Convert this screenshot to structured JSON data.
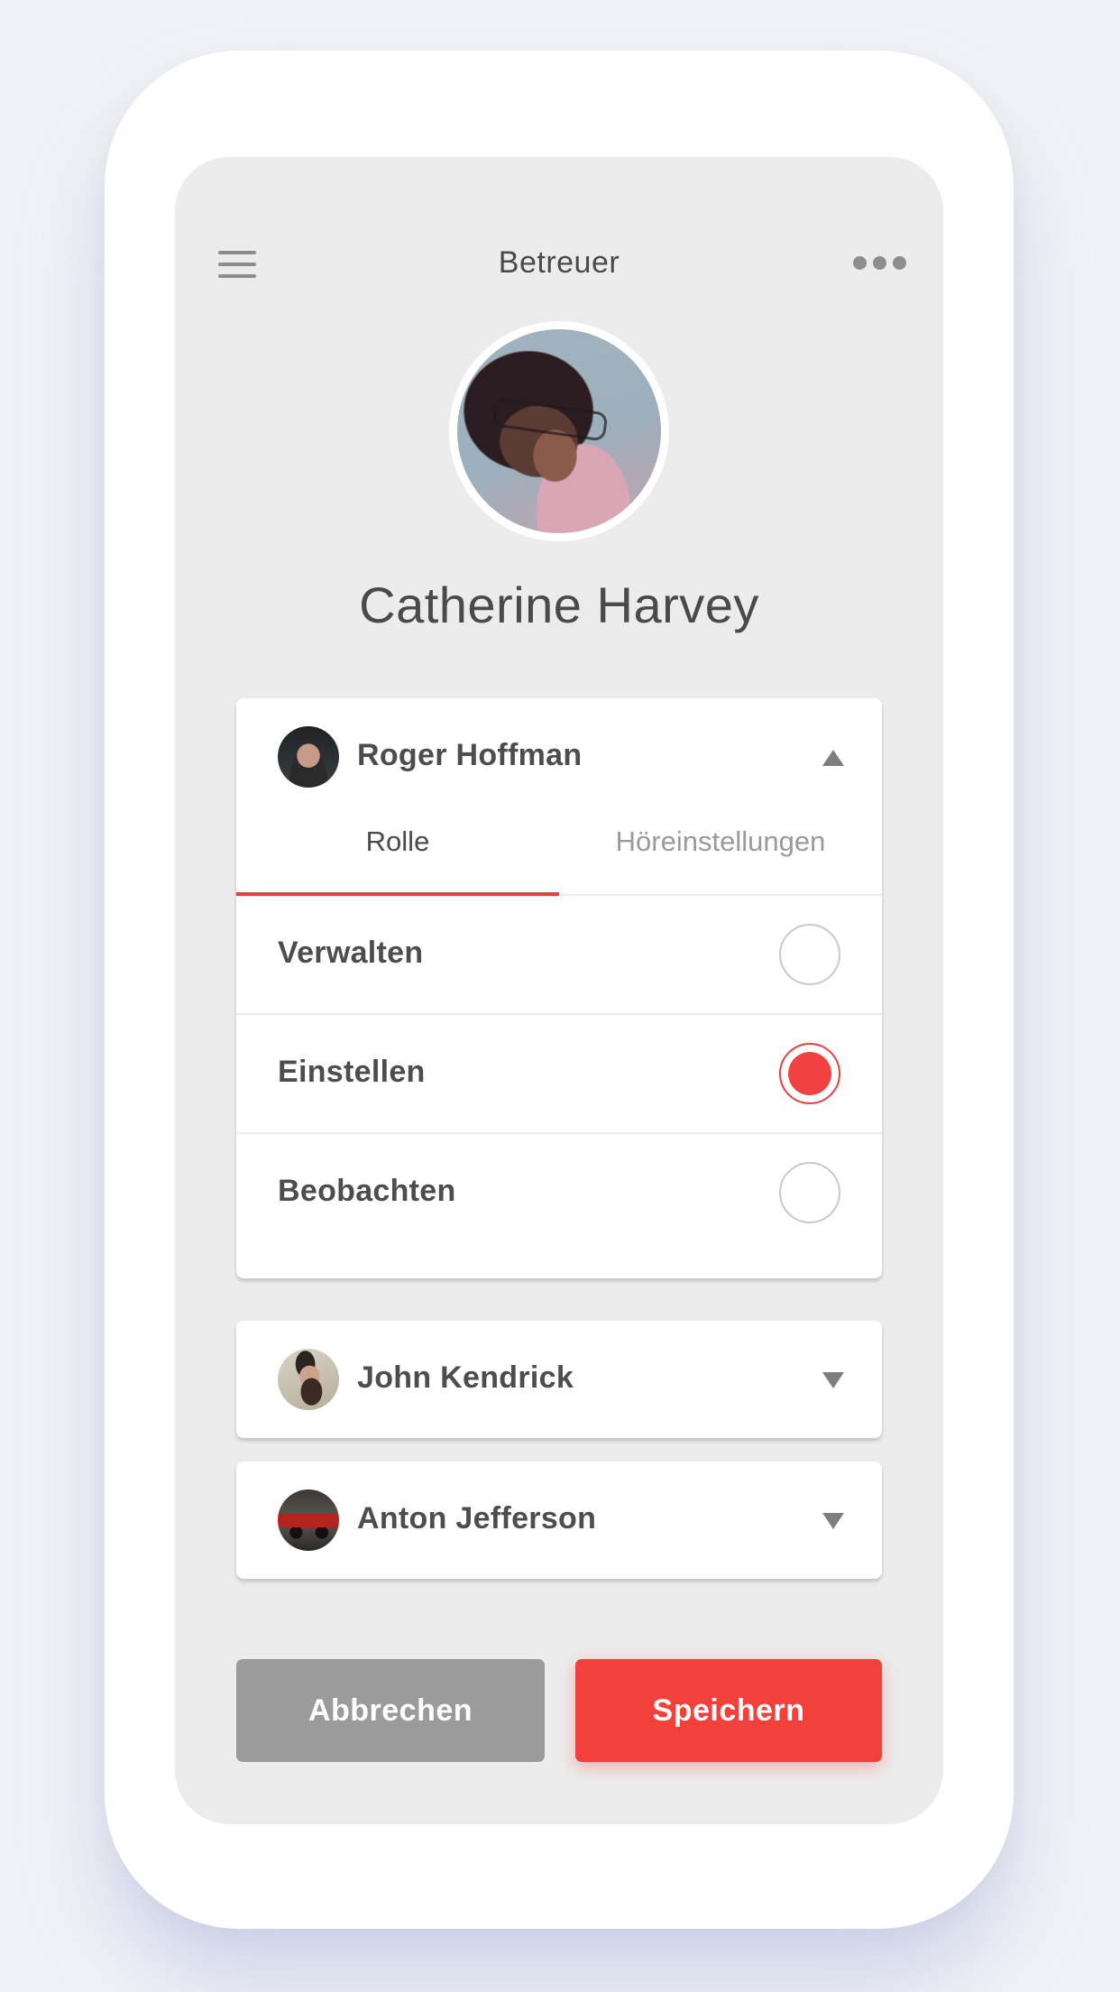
{
  "header": {
    "title": "Betreuer",
    "menu_icon": "hamburger-menu-icon",
    "more_icon": "more-dots-icon"
  },
  "profile": {
    "name": "Catherine Harvey",
    "avatar": "profile-avatar"
  },
  "caregivers": [
    {
      "name": "Roger Hoffman",
      "expanded": true,
      "caret_icon": "chevron-up-icon",
      "tabs": [
        {
          "label": "Rolle",
          "active": true
        },
        {
          "label": "Höreinstellungen",
          "active": false
        }
      ],
      "roles": [
        {
          "label": "Verwalten",
          "selected": false
        },
        {
          "label": "Einstellen",
          "selected": true
        },
        {
          "label": "Beobachten",
          "selected": false
        }
      ]
    },
    {
      "name": "John Kendrick",
      "expanded": false,
      "caret_icon": "chevron-down-icon"
    },
    {
      "name": "Anton Jefferson",
      "expanded": false,
      "caret_icon": "chevron-down-icon"
    }
  ],
  "actions": {
    "cancel_label": "Abbrechen",
    "save_label": "Speichern"
  },
  "colors": {
    "accent": "#f4403b",
    "cancel": "#9b9b9b",
    "screen_bg": "#ececec",
    "text": "#4a4a4a"
  }
}
